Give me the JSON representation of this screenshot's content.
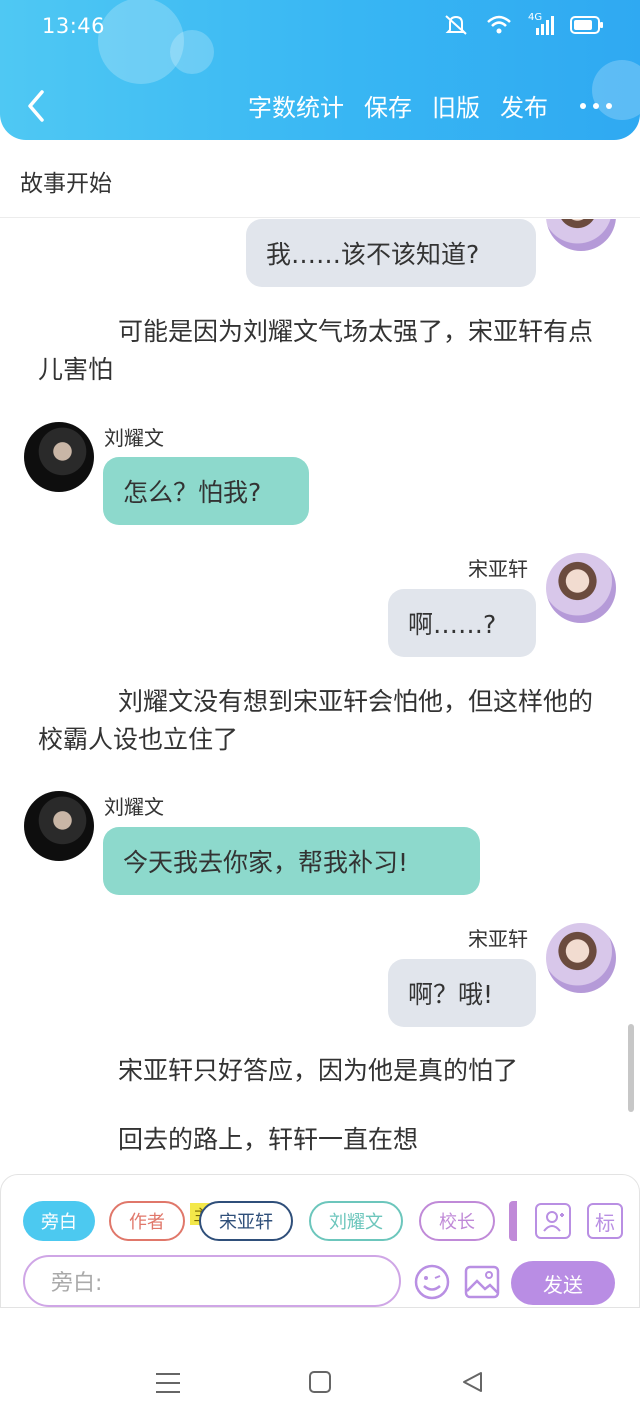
{
  "status": {
    "time": "13:46",
    "network": "4G"
  },
  "header": {
    "actions": [
      "字数统计",
      "保存",
      "旧版",
      "发布"
    ]
  },
  "chapter": {
    "title": "故事开始"
  },
  "content": {
    "msg1": "我……该不该知道?",
    "narr1": "可能是因为刘耀文气场太强了，宋亚轩有点儿害怕",
    "speaker_left": "刘耀文",
    "msg2": "怎么？怕我?",
    "speaker_right": "宋亚轩",
    "msg3": "啊……?",
    "narr2": "刘耀文没有想到宋亚轩会怕他，但这样他的校霸人设也立住了",
    "msg4": "今天我去你家，帮我补习!",
    "msg5": "啊？哦!",
    "narr3": "宋亚轩只好答应，因为他是真的怕了",
    "narr4": "回去的路上，轩轩一直在想"
  },
  "toolbar": {
    "roles": [
      {
        "label": "旁白",
        "color": "#4cc9f0"
      },
      {
        "label": "作者",
        "color": "#e0776a"
      },
      {
        "label": "宋亚轩",
        "color": "#2f4f7a"
      },
      {
        "label": "刘耀文",
        "color": "#6cc6bc"
      },
      {
        "label": "校长",
        "color": "#c08ad8"
      }
    ],
    "main_badge": "主",
    "tool_mark": "标",
    "input_placeholder": "旁白:",
    "send_label": "发送"
  },
  "colors": {
    "header": "#38b6f3",
    "left_bubble": "#8dd9cc",
    "right_bubble": "#e1e5ec",
    "accent": "#b98de4"
  }
}
